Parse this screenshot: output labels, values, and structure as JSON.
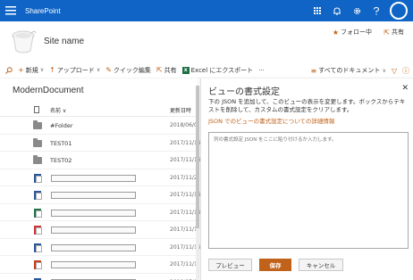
{
  "suite": {
    "brand": "SharePoint"
  },
  "site": {
    "name": "Site name",
    "follow": "フォロー中",
    "share": "共有"
  },
  "commands": {
    "new": "新規",
    "upload": "アップロード",
    "quick_edit": "クイック編集",
    "share": "共有",
    "excel_export": "Excel にエクスポート",
    "more": "···",
    "view": "すべてのドキュメント"
  },
  "library": {
    "title": "ModernDocument",
    "col_name": "名前",
    "col_modified": "更新日時",
    "rows": [
      {
        "type": "folder",
        "name": "#Folder",
        "date": "2018/06/0"
      },
      {
        "type": "folder",
        "name": "TEST01",
        "date": "2017/11/16"
      },
      {
        "type": "folder",
        "name": "TEST02",
        "date": "2017/11/16"
      },
      {
        "type": "word",
        "name": "",
        "date": "2017/11/2"
      },
      {
        "type": "word",
        "name": "",
        "date": "2017/11/16"
      },
      {
        "type": "excel",
        "name": "",
        "date": "2017/11/16"
      },
      {
        "type": "pdf",
        "name": "",
        "date": "2017/11/1"
      },
      {
        "type": "word",
        "name": "",
        "date": "2017/11/16"
      },
      {
        "type": "ppt",
        "name": "",
        "date": "2017/11/1"
      },
      {
        "type": "word",
        "name": "",
        "date": "2018/07/0"
      }
    ]
  },
  "panel": {
    "title": "ビューの書式設定",
    "description": "下の JSON を追加して、このビューの表示を変更します。ボックスからテキストを削除して、カスタムの書式設定をクリアします。",
    "link": "JSON でのビューの書式設定についての詳細情報",
    "placeholder": "列の書式設定 JSON をここに貼り付けるか入力します。",
    "preview": "プレビュー",
    "save": "保存",
    "cancel": "キャンセル"
  },
  "colors": {
    "suitebar": "#0f64c6",
    "accent": "#c0621a"
  }
}
